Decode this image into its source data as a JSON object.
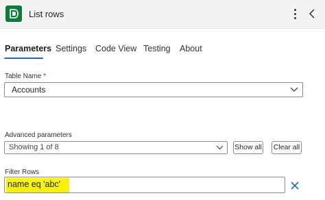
{
  "header": {
    "title": "List rows",
    "icon": "dataverse-logo-icon",
    "brand_color": "#0f7b3a",
    "more_icon": "more-vertical-icon",
    "collapse_icon": "chevron-left-icon"
  },
  "tabs": [
    {
      "label": "Parameters",
      "active": true
    },
    {
      "label": "Settings",
      "active": false
    },
    {
      "label": "Code View",
      "active": false
    },
    {
      "label": "Testing",
      "active": false
    },
    {
      "label": "About",
      "active": false
    }
  ],
  "table_name": {
    "label": "Table Name",
    "required_marker": "*",
    "value": "Accounts"
  },
  "advanced": {
    "label": "Advanced parameters",
    "selected": "Showing 1 of 8",
    "show_all_label": "Show all",
    "clear_all_label": "Clear all"
  },
  "filter_rows": {
    "label": "Filter Rows",
    "value": "name eq 'abc'",
    "highlight_color": "#f8f200",
    "clear_icon": "close-icon"
  },
  "colors": {
    "accent": "#2266c4",
    "required": "#c50f1f"
  }
}
